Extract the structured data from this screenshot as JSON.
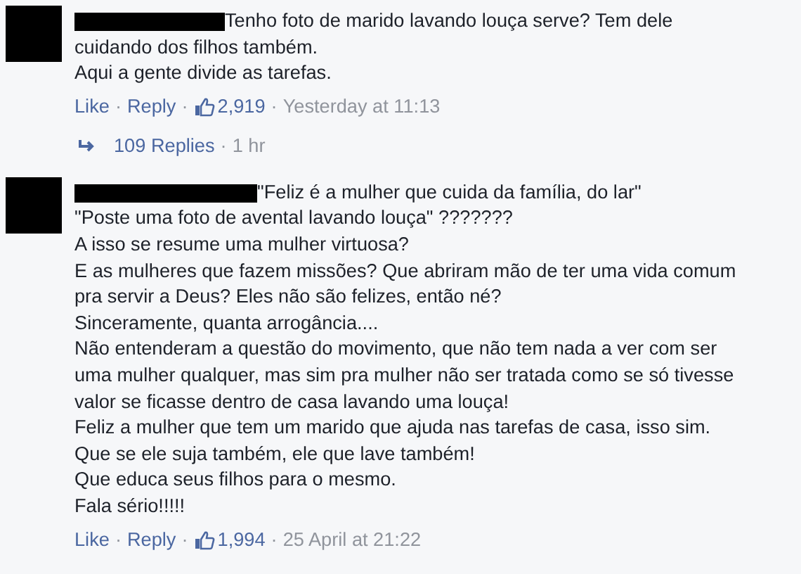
{
  "separator": "·",
  "comments": [
    {
      "lines": [
        "Tenho foto de marido lavando louça serve? Tem dele",
        "cuidando dos filhos também.",
        "Aqui a gente divide as tarefas."
      ],
      "actions": {
        "like": "Like",
        "reply": "Reply",
        "likes": "2,919",
        "time": "Yesterday at 11:13"
      },
      "replies": {
        "label": "109 Replies",
        "time": "1 hr"
      }
    },
    {
      "lines": [
        "\"Feliz é a mulher que cuida da família, do lar\"",
        "\"Poste uma foto de avental lavando louça\" ???????",
        "A isso se resume uma mulher virtuosa?",
        "E as mulheres que fazem missões? Que abriram mão de ter uma vida comum",
        "pra servir a Deus? Eles não são felizes, então né?",
        "Sinceramente, quanta arrogância....",
        "Não entenderam a questão do movimento, que não tem nada a ver com ser",
        "uma mulher qualquer, mas sim pra mulher não ser tratada como se só tivesse",
        "valor se ficasse dentro de casa lavando uma louça!",
        "Feliz a mulher que tem um marido que ajuda nas tarefas de casa, isso sim.",
        "Que se ele suja também, ele que lave também!",
        "Que educa seus filhos para o mesmo.",
        "Fala sério!!!!!"
      ],
      "actions": {
        "like": "Like",
        "reply": "Reply",
        "likes": "1,994",
        "time": "25 April at 21:22"
      }
    }
  ]
}
